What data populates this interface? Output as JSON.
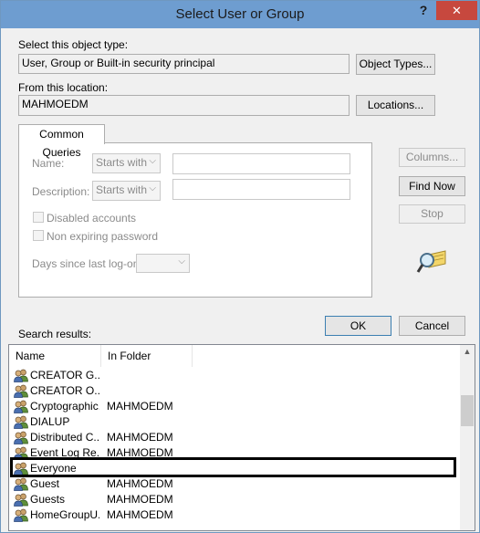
{
  "window": {
    "title": "Select User or Group",
    "help_glyph": "?",
    "close_glyph": "✕"
  },
  "object_type": {
    "label": "Select this object type:",
    "value": "User, Group or Built-in security principal",
    "button": "Object Types..."
  },
  "location": {
    "label": "From this location:",
    "value": "MAHMOEDM",
    "button": "Locations..."
  },
  "common_queries": {
    "tab_label": "Common Queries",
    "name_label": "Name:",
    "name_mode": "Starts with",
    "description_label": "Description:",
    "description_mode": "Starts with",
    "disabled_accounts_label": "Disabled accounts",
    "non_expiring_password_label": "Non expiring password",
    "days_since_logon_label": "Days since last log-on:"
  },
  "side_buttons": {
    "columns": "Columns...",
    "find_now": "Find Now",
    "stop": "Stop"
  },
  "dialog_buttons": {
    "ok": "OK",
    "cancel": "Cancel"
  },
  "results": {
    "label": "Search results:",
    "columns": [
      "Name",
      "In Folder"
    ],
    "rows": [
      {
        "name": "CREATOR G...",
        "folder": ""
      },
      {
        "name": "CREATOR O...",
        "folder": ""
      },
      {
        "name": "Cryptographic...",
        "folder": "MAHMOEDM"
      },
      {
        "name": "DIALUP",
        "folder": ""
      },
      {
        "name": "Distributed C...",
        "folder": "MAHMOEDM"
      },
      {
        "name": "Event Log Re...",
        "folder": "MAHMOEDM"
      },
      {
        "name": "Everyone",
        "folder": ""
      },
      {
        "name": "Guest",
        "folder": "MAHMOEDM"
      },
      {
        "name": "Guests",
        "folder": "MAHMOEDM"
      },
      {
        "name": "HomeGroupU...",
        "folder": "MAHMOEDM"
      }
    ],
    "selected_row": "Everyone"
  },
  "colors": {
    "titlebar": "#6e9dd0",
    "close": "#c7483e",
    "highlight_border": "#000000"
  }
}
